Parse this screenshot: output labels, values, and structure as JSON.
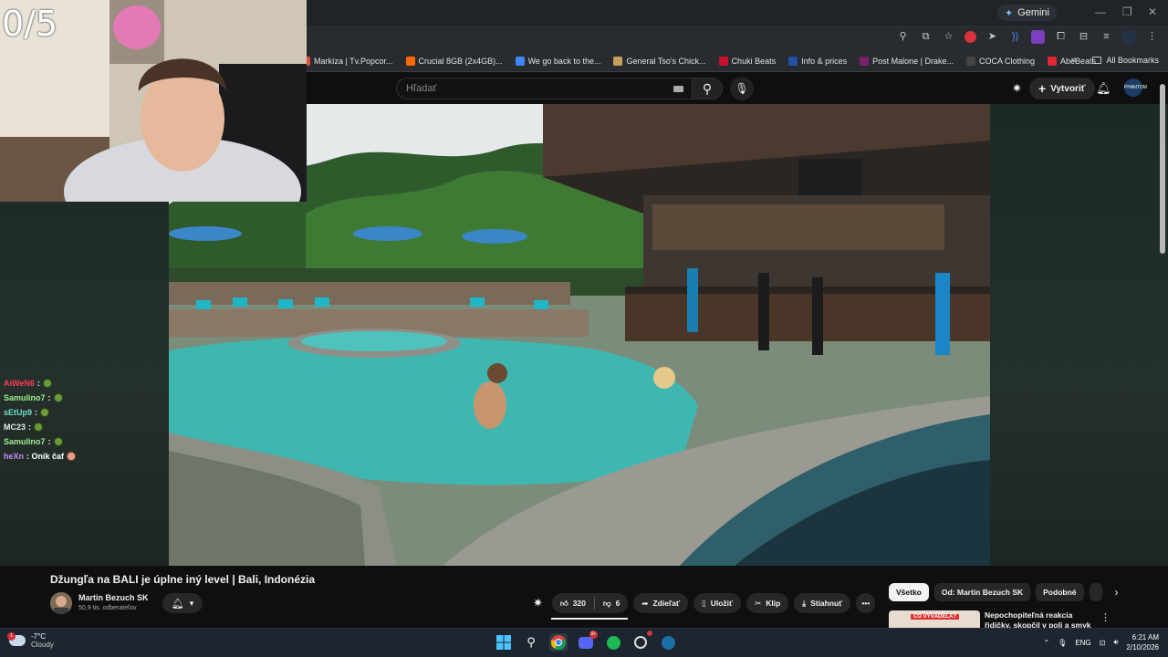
{
  "browser": {
    "gemini_label": "Gemini",
    "bookmarks": [
      {
        "label": "Markíza | Tv.Popcor...",
        "color": "#e0533c"
      },
      {
        "label": "Crucial 8GB (2x4GB)...",
        "color": "#ff6a00"
      },
      {
        "label": "We go back to the...",
        "color": "#4285f4"
      },
      {
        "label": "General Tso's Chick...",
        "color": "#c5a05a"
      },
      {
        "label": "Chuki Beats",
        "color": "#c8102e"
      },
      {
        "label": "Info & prices",
        "color": "#2251a3"
      },
      {
        "label": "Post Malone | Drake...",
        "color": "#7a1f6b"
      },
      {
        "label": "COCA Clothing",
        "color": "#444444"
      },
      {
        "label": "AbeBeats",
        "color": "#e3262f"
      }
    ],
    "bookmarks_more": "»",
    "all_bookmarks": "All Bookmarks"
  },
  "youtube": {
    "search_placeholder": "Hľadať",
    "create_label": "Vytvoriť",
    "avatar_text": "PHANTOM"
  },
  "overlay": {
    "counter": "0/5",
    "chat": [
      {
        "user": "AiWeN6",
        "color": "#ff3b53",
        "msg": ":",
        "emote": true
      },
      {
        "user": "Samulino7",
        "color": "#9ff08f",
        "msg": ":",
        "emote": true
      },
      {
        "user": "sEtUp9",
        "color": "#6fe0c3",
        "msg": ":",
        "emote": true
      },
      {
        "user": "MC23",
        "color": "#e9e9e9",
        "msg": ":",
        "emote": true
      },
      {
        "user": "Samulino7",
        "color": "#9ff08f",
        "msg": ":",
        "emote": true
      },
      {
        "user": "heXn",
        "color": "#c98bff",
        "msg": ": Onik čaf",
        "emote": true
      }
    ]
  },
  "video_info": {
    "title": "Džungľa na BALI je úplne iný level | Bali, Indonézia",
    "channel_name": "Martin Bezuch SK",
    "subscribers": "50,9 tis. odberateľov",
    "likes": "320",
    "dislikes": "6",
    "share_label": "Zdieľať",
    "save_label": "Uložiť",
    "clip_label": "Klip",
    "download_label": "Stiahnuť",
    "more_label": "•••"
  },
  "recommendations": {
    "chips": [
      {
        "label": "Všetko",
        "active": true
      },
      {
        "label": "Od: Martin Bezuch SK",
        "active": false
      },
      {
        "label": "Podobné",
        "active": false
      }
    ],
    "first_video_title": "Nepochopiteľná reakcia řidičky, skopčil v poli a smyk na ledov...",
    "first_video_overlay": "CO VYVÁDĚLA?"
  },
  "taskbar": {
    "temperature": "-7°C",
    "weather": "Cloudy",
    "weather_badge": "1",
    "discord_badge": "9+",
    "language": "ENG",
    "time": "6:21 AM",
    "date": "2/10/2026"
  }
}
